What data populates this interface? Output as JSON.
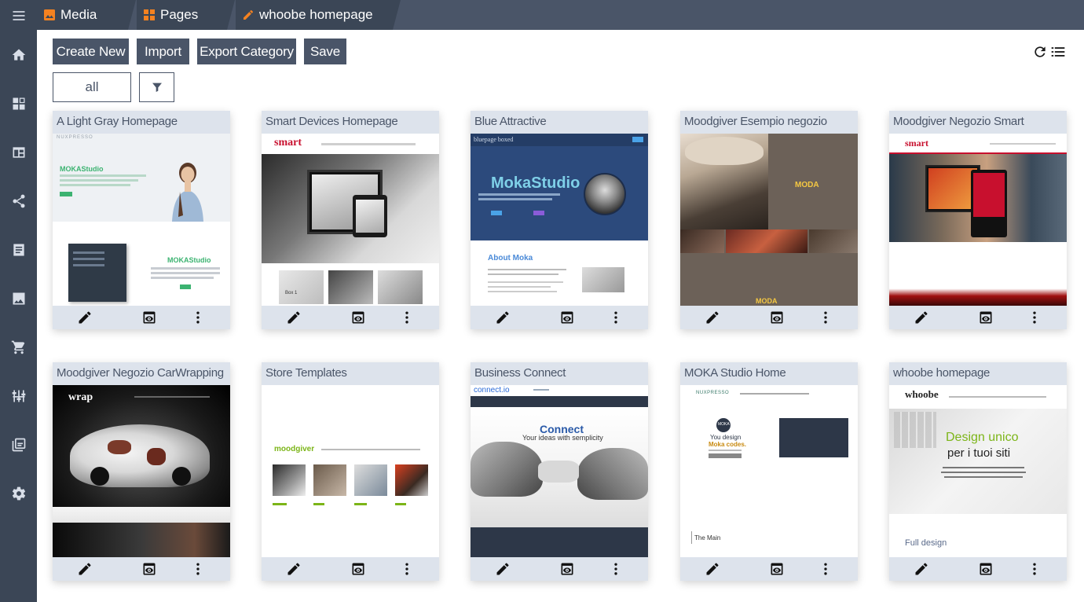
{
  "tabs": [
    {
      "label": "Media",
      "icon": "image-icon"
    },
    {
      "label": "Pages",
      "icon": "pages-icon"
    },
    {
      "label": "whoobe homepage",
      "icon": "pencil-icon"
    }
  ],
  "sidebar": {
    "items": [
      "menu-icon",
      "home-icon",
      "dashboard-icon",
      "layout-icon",
      "share-icon",
      "article-icon",
      "image-icon",
      "cart-icon",
      "sliders-icon",
      "library-icon",
      "settings-icon"
    ]
  },
  "toolbar": {
    "create_new": "Create New",
    "import": "Import",
    "export_category": "Export Category",
    "save": "Save"
  },
  "filter": {
    "value": "all"
  },
  "cards": [
    {
      "title": "A Light Gray Homepage"
    },
    {
      "title": "Smart Devices Homepage"
    },
    {
      "title": "Blue Attractive"
    },
    {
      "title": "Moodgiver Esempio negozio"
    },
    {
      "title": "Moodgiver Negozio Smart"
    },
    {
      "title": "Moodgiver Negozio CarWrapping"
    },
    {
      "title": "Store Templates"
    },
    {
      "title": "Business Connect"
    },
    {
      "title": "MOKA Studio Home"
    },
    {
      "title": "whoobe homepage"
    }
  ],
  "thumbs": {
    "t1_logo": "NUXPRESSO",
    "t1_heading": "MOKAStudio",
    "t1_heading2": "MOKAStudio",
    "t2_logo": "smart",
    "t2_caption": "Box 1",
    "t3_brand": "bluepage boxed",
    "t3_heading": "MokaStudio",
    "t3_about": "About Moka",
    "t4_brand": "MODA",
    "t4_brand2": "MODA",
    "t5_logo": "smart",
    "t6_logo": "wrap",
    "t7_logo": "moodgiver",
    "t8_logo": "connect.io",
    "t8_heading": "Connect",
    "t8_sub": "Your ideas with semplicity",
    "t9_logo": "NUXPRESSO",
    "t9_line1": "You design",
    "t9_line2": "Moka codes.",
    "t9_badge": "MOKA",
    "t9_main": "The Main",
    "t10_logo": "whoobe",
    "t10_heading1": "Design unico",
    "t10_heading2": "per i tuoi siti",
    "t10_full": "Full design"
  },
  "colors": {
    "sidebar": "#3b4656",
    "tabbar": "#4a5568",
    "button": "#4a5568",
    "card_header": "#dde3ec",
    "accent_orange": "#f58220"
  }
}
